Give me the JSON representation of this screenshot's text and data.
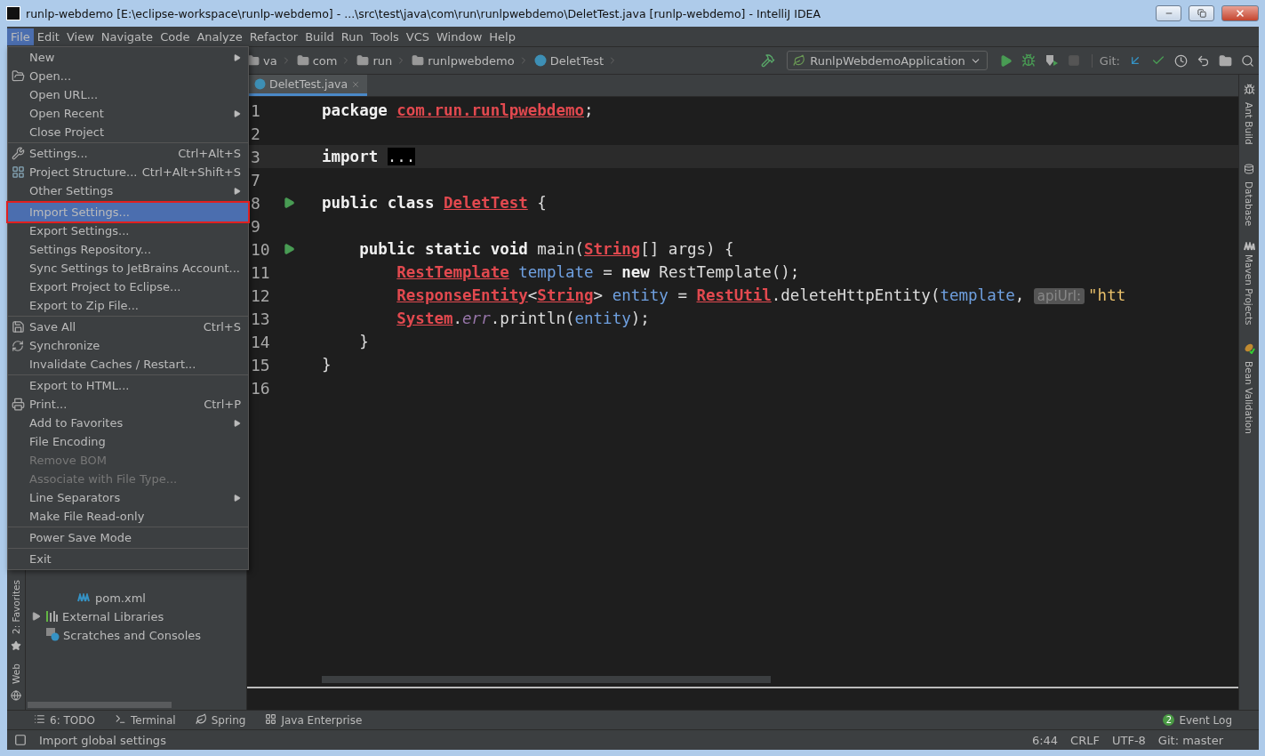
{
  "window": {
    "title": "runlp-webdemo [E:\\eclipse-workspace\\runlp-webdemo] - ...\\src\\test\\java\\com\\run\\runlpwebdemo\\DeletTest.java [runlp-webdemo] - IntelliJ IDEA"
  },
  "menu_bar": [
    {
      "label": "File",
      "selected": true
    },
    {
      "label": "Edit",
      "selected": false
    },
    {
      "label": "View",
      "selected": false
    },
    {
      "label": "Navigate",
      "selected": false
    },
    {
      "label": "Code",
      "selected": false
    },
    {
      "label": "Analyze",
      "selected": false
    },
    {
      "label": "Refactor",
      "selected": false
    },
    {
      "label": "Build",
      "selected": false
    },
    {
      "label": "Run",
      "selected": false
    },
    {
      "label": "Tools",
      "selected": false
    },
    {
      "label": "VCS",
      "selected": false
    },
    {
      "label": "Window",
      "selected": false
    },
    {
      "label": "Help",
      "selected": false
    }
  ],
  "breadcrumbs": [
    {
      "label": "va",
      "kind": "folder"
    },
    {
      "label": "com",
      "kind": "folder"
    },
    {
      "label": "run",
      "kind": "folder"
    },
    {
      "label": "runlpwebdemo",
      "kind": "folder"
    },
    {
      "label": "DeletTest",
      "kind": "class"
    }
  ],
  "run_config": "RunlpWebdemoApplication",
  "git_label": "Git:",
  "editor_tabs": [
    {
      "label": "DeletTest.java",
      "selected": true
    }
  ],
  "code_lines": [
    {
      "number": "1",
      "current": false,
      "runnable": false,
      "tokens": [
        {
          "kind": "kw",
          "text": "package "
        },
        {
          "kind": "err",
          "text": "com.run.runlpwebdemo"
        },
        {
          "kind": "plain",
          "text": ";"
        }
      ]
    },
    {
      "number": "2",
      "current": false,
      "runnable": false
    },
    {
      "number": "3",
      "current": true,
      "runnable": false,
      "tokens": [
        {
          "kind": "kw",
          "text": "import "
        },
        {
          "kind": "fold",
          "text": "..."
        }
      ]
    },
    {
      "number": "7",
      "current": false,
      "runnable": false
    },
    {
      "number": "8",
      "current": false,
      "runnable": true,
      "tokens": [
        {
          "kind": "kw",
          "text": "public class "
        },
        {
          "kind": "err",
          "text": "DeletTest"
        },
        {
          "kind": "plain",
          "text": " {"
        }
      ]
    },
    {
      "number": "9",
      "current": false,
      "runnable": false
    },
    {
      "number": "10",
      "current": false,
      "runnable": true,
      "tokens": [
        {
          "kind": "kw",
          "text": "    public static void "
        },
        {
          "kind": "plain",
          "text": "main("
        },
        {
          "kind": "err",
          "text": "String"
        },
        {
          "kind": "plain",
          "text": "[] args) {"
        }
      ]
    },
    {
      "number": "11",
      "current": false,
      "runnable": false,
      "tokens": [
        {
          "kind": "err",
          "text": "        RestTemplate"
        },
        {
          "kind": "ident",
          "text": " template"
        },
        {
          "kind": "plain",
          "text": " = "
        },
        {
          "kind": "kw",
          "text": "new "
        },
        {
          "kind": "plain",
          "text": "RestTemplate();"
        }
      ]
    },
    {
      "number": "12",
      "current": false,
      "runnable": false,
      "tokens": [
        {
          "kind": "err",
          "text": "        ResponseEntity"
        },
        {
          "kind": "plain",
          "text": "<"
        },
        {
          "kind": "err",
          "text": "String"
        },
        {
          "kind": "plain",
          "text": "> "
        },
        {
          "kind": "ident",
          "text": "entity"
        },
        {
          "kind": "plain",
          "text": " = "
        },
        {
          "kind": "err",
          "text": "RestUtil"
        },
        {
          "kind": "plain",
          "text": ".deleteHttpEntity("
        },
        {
          "kind": "ident",
          "text": "template"
        },
        {
          "kind": "plain",
          "text": ", "
        },
        {
          "kind": "hint",
          "text": "apiUrl:"
        },
        {
          "kind": "str",
          "text": "\"htt"
        }
      ]
    },
    {
      "number": "13",
      "current": false,
      "runnable": false,
      "tokens": [
        {
          "kind": "err",
          "text": "        System"
        },
        {
          "kind": "plain",
          "text": "."
        },
        {
          "kind": "field",
          "text": "err"
        },
        {
          "kind": "plain",
          "text": ".println("
        },
        {
          "kind": "ident",
          "text": "entity"
        },
        {
          "kind": "plain",
          "text": ");"
        }
      ]
    },
    {
      "number": "14",
      "current": false,
      "runnable": false,
      "tokens": [
        {
          "kind": "plain",
          "text": "    }"
        }
      ]
    },
    {
      "number": "15",
      "current": false,
      "runnable": false,
      "tokens": [
        {
          "kind": "plain",
          "text": "}"
        }
      ]
    },
    {
      "number": "16",
      "current": false,
      "runnable": false
    }
  ],
  "file_menu": [
    [
      {
        "label": "New",
        "kind": "plain",
        "submenu": true,
        "disabled": false,
        "selected": false,
        "outlined": false
      },
      {
        "label": "Open...",
        "kind": "folder",
        "submenu": false,
        "disabled": false,
        "selected": false,
        "outlined": false
      },
      {
        "label": "Open URL...",
        "kind": "plain",
        "submenu": false,
        "disabled": false,
        "selected": false,
        "outlined": false
      },
      {
        "label": "Open Recent",
        "kind": "plain",
        "submenu": true,
        "disabled": false,
        "selected": false,
        "outlined": false
      },
      {
        "label": "Close Project",
        "kind": "plain",
        "submenu": false,
        "disabled": false,
        "selected": false,
        "outlined": false
      }
    ],
    [
      {
        "label": "Settings...",
        "kind": "wrench",
        "shortcut": "Ctrl+Alt+S",
        "submenu": false,
        "disabled": false,
        "selected": false,
        "outlined": false
      },
      {
        "label": "Project Structure...",
        "kind": "grid",
        "shortcut": "Ctrl+Alt+Shift+S",
        "submenu": false,
        "disabled": false,
        "selected": false,
        "outlined": false
      },
      {
        "label": "Other Settings",
        "kind": "plain",
        "submenu": true,
        "disabled": false,
        "selected": false,
        "outlined": false
      }
    ],
    [
      {
        "label": "Import Settings...",
        "kind": "plain",
        "submenu": false,
        "disabled": false,
        "selected": true,
        "outlined": true
      },
      {
        "label": "Export Settings...",
        "kind": "plain",
        "submenu": false,
        "disabled": false,
        "selected": false,
        "outlined": false
      },
      {
        "label": "Settings Repository...",
        "kind": "plain",
        "submenu": false,
        "disabled": false,
        "selected": false,
        "outlined": false
      },
      {
        "label": "Sync Settings to JetBrains Account...",
        "kind": "plain",
        "submenu": false,
        "disabled": false,
        "selected": false,
        "outlined": false
      },
      {
        "label": "Export Project to Eclipse...",
        "kind": "plain",
        "submenu": false,
        "disabled": false,
        "selected": false,
        "outlined": false
      },
      {
        "label": "Export to Zip File...",
        "kind": "plain",
        "submenu": false,
        "disabled": false,
        "selected": false,
        "outlined": false
      }
    ],
    [
      {
        "label": "Save All",
        "kind": "save",
        "shortcut": "Ctrl+S",
        "submenu": false,
        "disabled": false,
        "selected": false,
        "outlined": false
      },
      {
        "label": "Synchronize",
        "kind": "sync",
        "submenu": false,
        "disabled": false,
        "selected": false,
        "outlined": false
      },
      {
        "label": "Invalidate Caches / Restart...",
        "kind": "plain",
        "submenu": false,
        "disabled": false,
        "selected": false,
        "outlined": false
      }
    ],
    [
      {
        "label": "Export to HTML...",
        "kind": "plain",
        "submenu": false,
        "disabled": false,
        "selected": false,
        "outlined": false
      },
      {
        "label": "Print...",
        "kind": "print",
        "shortcut": "Ctrl+P",
        "submenu": false,
        "disabled": false,
        "selected": false,
        "outlined": false
      },
      {
        "label": "Add to Favorites",
        "kind": "plain",
        "submenu": true,
        "disabled": false,
        "selected": false,
        "outlined": false
      },
      {
        "label": "File Encoding",
        "kind": "plain",
        "submenu": false,
        "disabled": false,
        "selected": false,
        "outlined": false
      },
      {
        "label": "Remove BOM",
        "kind": "plain",
        "submenu": false,
        "disabled": true,
        "selected": false,
        "outlined": false
      },
      {
        "label": "Associate with File Type...",
        "kind": "plain",
        "submenu": false,
        "disabled": true,
        "selected": false,
        "outlined": false
      },
      {
        "label": "Line Separators",
        "kind": "plain",
        "submenu": true,
        "disabled": false,
        "selected": false,
        "outlined": false
      },
      {
        "label": "Make File Read-only",
        "kind": "plain",
        "submenu": false,
        "disabled": false,
        "selected": false,
        "outlined": false
      }
    ],
    [
      {
        "label": "Power Save Mode",
        "kind": "plain",
        "submenu": false,
        "disabled": false,
        "selected": false,
        "outlined": false
      }
    ],
    [
      {
        "label": "Exit",
        "kind": "plain",
        "submenu": false,
        "disabled": false,
        "selected": false,
        "outlined": false
      }
    ]
  ],
  "project_tree": [
    {
      "label": "pom.xml",
      "kind": "maven"
    },
    {
      "label": "External Libraries",
      "kind": "libraries",
      "expanded": false
    },
    {
      "label": "Scratches and Consoles",
      "kind": "scratches"
    }
  ],
  "left_stripe": [
    {
      "label": "2: Favorites",
      "kind": "star"
    },
    {
      "label": "Web",
      "kind": "globe"
    }
  ],
  "right_stripe": [
    {
      "label": "Ant Build",
      "kind": "ant"
    },
    {
      "label": "Database",
      "kind": "database"
    },
    {
      "label": "Maven Projects",
      "kind": "maven"
    },
    {
      "label": "Bean Validation",
      "kind": "bean"
    }
  ],
  "tool_windows": [
    {
      "label": "6: TODO",
      "kind": "list"
    },
    {
      "label": "Terminal",
      "kind": "terminal"
    },
    {
      "label": "Spring",
      "kind": "leaf"
    },
    {
      "label": "Java Enterprise",
      "kind": "ee"
    }
  ],
  "event_log": {
    "label": "Event Log",
    "count": "2"
  },
  "status_bar": {
    "message": "Import global settings",
    "items": [
      "6:44",
      "CRLF",
      "UTF-8",
      "Git: master"
    ]
  }
}
